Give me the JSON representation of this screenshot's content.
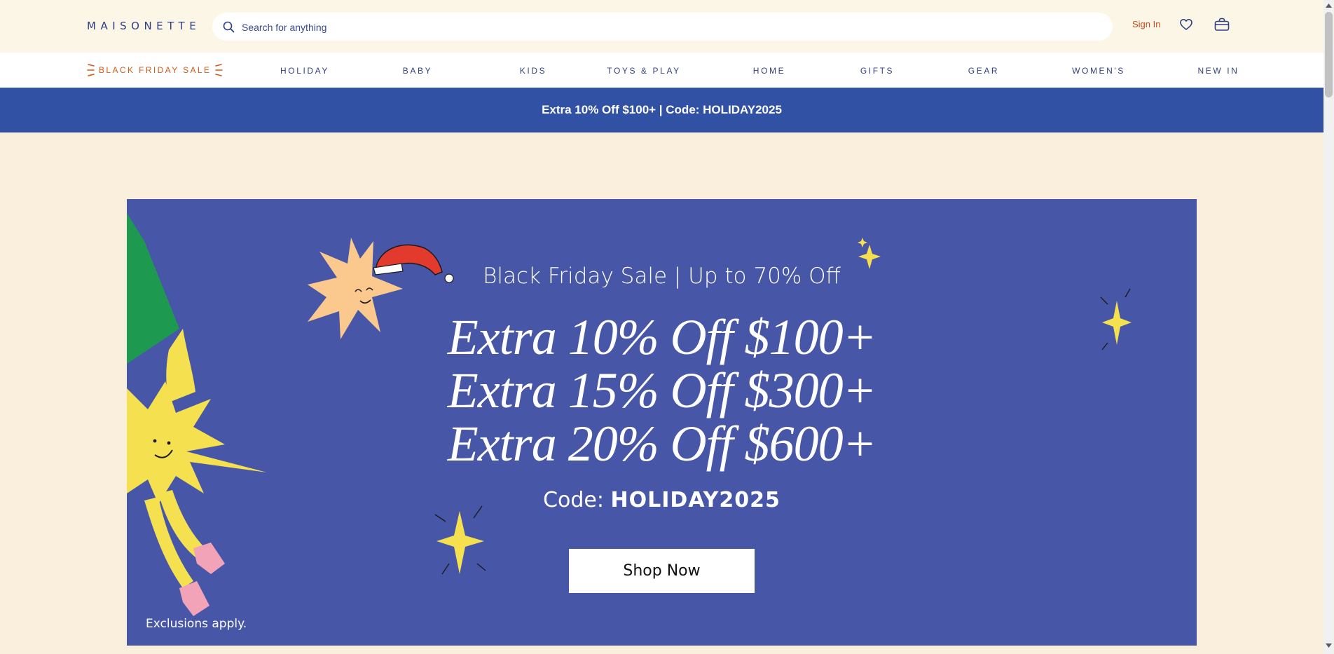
{
  "header": {
    "logo": "MAISONETTE",
    "search_placeholder": "Search for anything",
    "signin_label": "Sign In"
  },
  "nav": {
    "sale_label": "BLACK FRIDAY SALE",
    "items": [
      "HOLIDAY",
      "BABY",
      "KIDS",
      "TOYS & PLAY",
      "HOME",
      "GIFTS",
      "GEAR",
      "WOMEN'S",
      "NEW IN"
    ]
  },
  "promo_bar": {
    "text": "Extra 10% Off $100+ | Code: HOLIDAY2025"
  },
  "hero": {
    "subhead": "Black Friday Sale | Up to 70% Off",
    "offers": [
      "Extra 10% Off $100+",
      "Extra 15% Off $300+",
      "Extra 20% Off $600+"
    ],
    "code_label": "Code:",
    "code_value": "HOLIDAY2025",
    "cta_label": "Shop Now",
    "disclaimer": "Exclusions apply."
  },
  "colors": {
    "brand_navy": "#2c3e86",
    "sale_orange": "#d35b1a",
    "promo_blue": "#3152a4",
    "hero_blue": "#4756a6",
    "page_cream": "#f9efdc"
  }
}
